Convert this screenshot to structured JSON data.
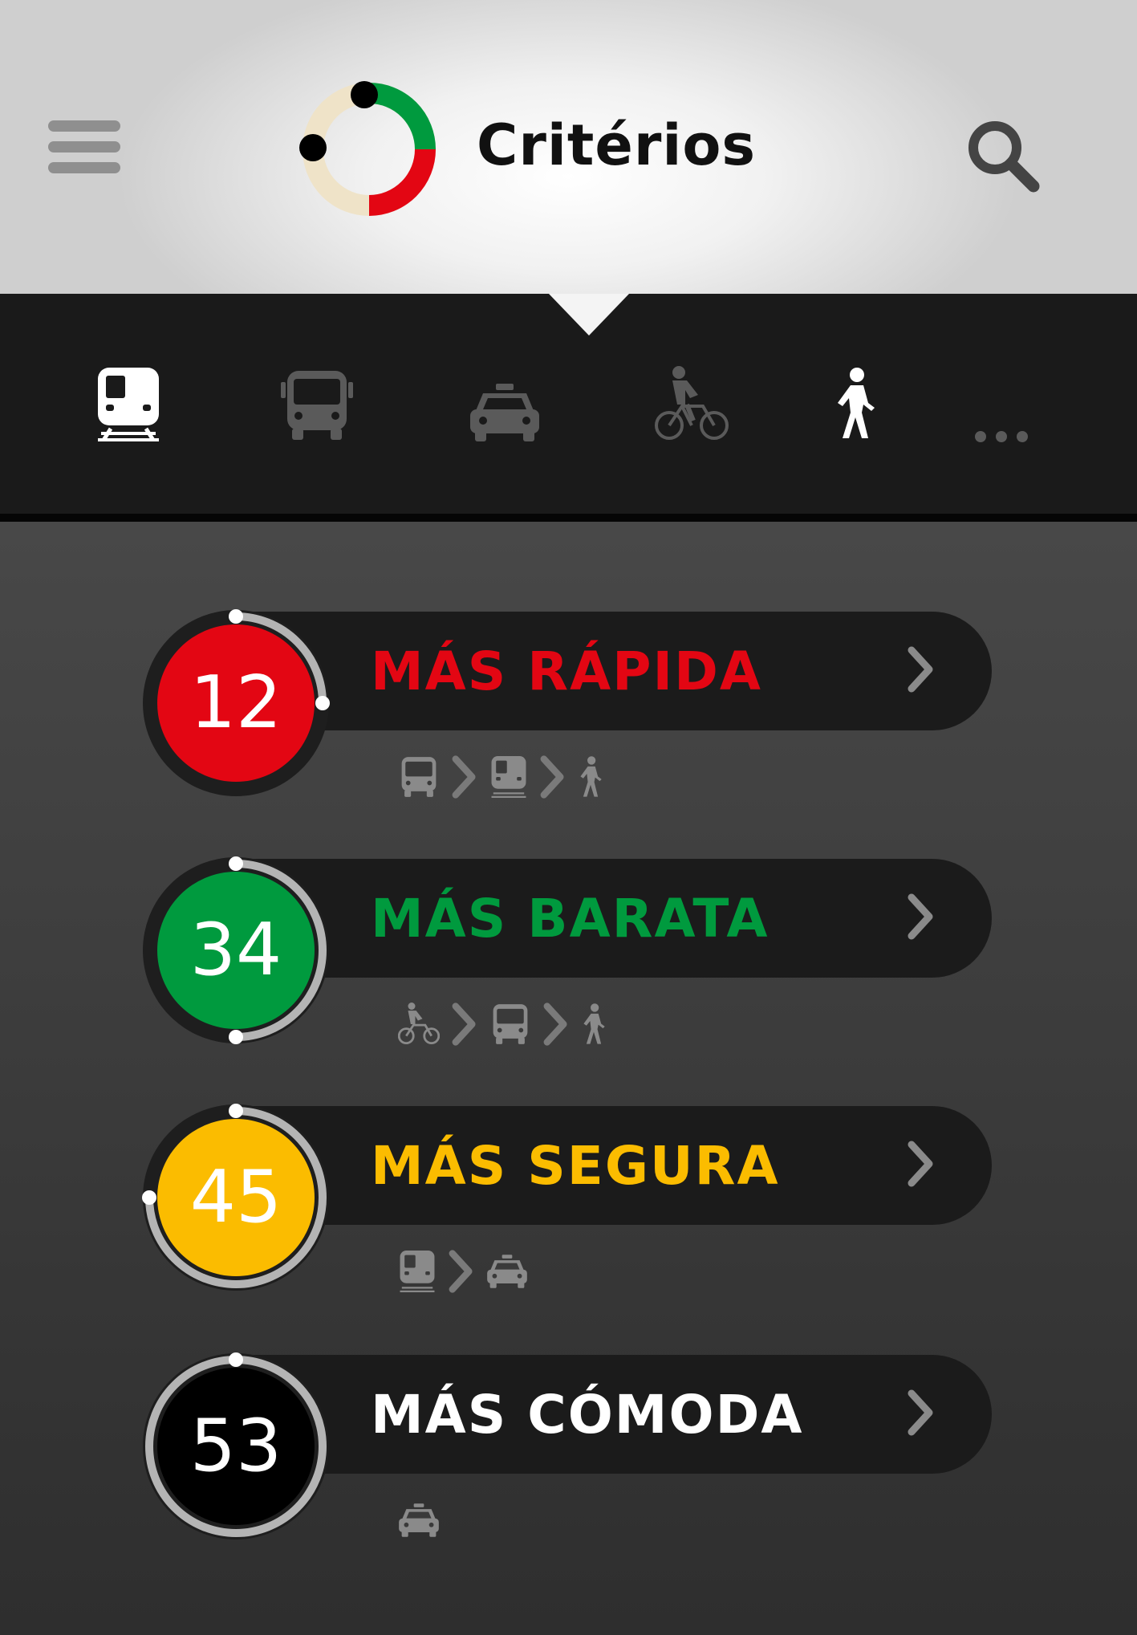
{
  "header": {
    "title": "Critérios",
    "menu_icon": "hamburger-menu-icon",
    "search_icon": "search-icon"
  },
  "modes": [
    {
      "name": "train",
      "icon": "train-icon",
      "active": true
    },
    {
      "name": "bus",
      "icon": "bus-icon",
      "active": false
    },
    {
      "name": "taxi",
      "icon": "taxi-icon",
      "active": false
    },
    {
      "name": "bicycle",
      "icon": "bicycle-icon",
      "active": false
    },
    {
      "name": "walk",
      "icon": "walking-icon",
      "active": false
    },
    {
      "name": "more",
      "icon": "more-dots-icon",
      "active": false
    }
  ],
  "routes": [
    {
      "label": "MÁS RÁPIDA",
      "number": "12",
      "color": "#e30613",
      "progress": 0.25,
      "steps": [
        "bus-icon",
        "train-icon",
        "walking-icon"
      ]
    },
    {
      "label": "MÁS BARATA",
      "number": "34",
      "color": "#009a3e",
      "progress": 0.5,
      "steps": [
        "bicycle-icon",
        "bus-icon",
        "walking-icon"
      ]
    },
    {
      "label": "MÁS SEGURA",
      "number": "45",
      "color": "#fbbc00",
      "progress": 0.75,
      "steps": [
        "train-icon",
        "taxi-icon"
      ]
    },
    {
      "label": "MÁS CÓMODA",
      "number": "53",
      "color": "#000000",
      "label_color": "#ffffff",
      "progress": 1.0,
      "steps": [
        "taxi-icon"
      ]
    }
  ],
  "colors": {
    "accent_red": "#e30613",
    "accent_green": "#009a3e",
    "accent_yellow": "#fbbc00",
    "logo_beige": "#efe3c8",
    "icon_inactive": "#5a5a5a",
    "icon_step": "#8a8a8a"
  }
}
